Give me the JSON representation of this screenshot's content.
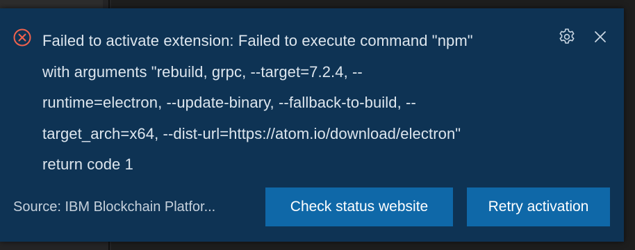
{
  "notification": {
    "severity": "error",
    "message": "Failed to activate extension: Failed to execute command \"npm\"\nwith arguments \"rebuild, grpc, --target=7.2.4, --\nruntime=electron, --update-binary, --fallback-to-build, --\ntarget_arch=x64, --dist-url=https://atom.io/download/electron\"\nreturn code 1",
    "source": "Source: IBM Blockchain Platfor...",
    "icons": {
      "error": "error-circle-x-icon",
      "settings": "gear-icon",
      "close": "close-icon"
    },
    "actions": [
      {
        "label": "Check status website"
      },
      {
        "label": "Retry activation"
      }
    ]
  },
  "colors": {
    "toast_background": "#0e3354",
    "error": "#f0624d",
    "button_background": "#0f68a8",
    "text": "#dde6ee"
  }
}
